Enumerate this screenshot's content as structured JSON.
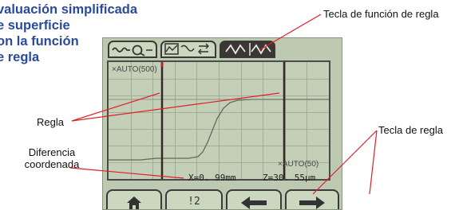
{
  "heading": {
    "lines": [
      "valuación simplificada",
      "e superficie",
      "on la función",
      "e regla"
    ]
  },
  "callouts": {
    "function_key": "Tecla de función de regla",
    "ruler": "Regla",
    "coord_diff_1": "Diferencia",
    "coord_diff_2": "coordenada",
    "ruler_key": "Tecla de regla"
  },
  "screen": {
    "y_axis_label": "×AUTO(500)",
    "x_axis_label": "×AUTO(50)",
    "readout_x": "X=0. 99mm",
    "readout_z": "Z=30. 55μm",
    "buttons": {
      "home_icon": "home-icon",
      "page": "!2",
      "left_icon": "arrow-left-icon",
      "right_icon": "arrow-right-icon"
    }
  },
  "colors": {
    "heading": "#2a4a9c",
    "lcd_background": "#bdc9b0",
    "callout_line": "#e0202a"
  }
}
